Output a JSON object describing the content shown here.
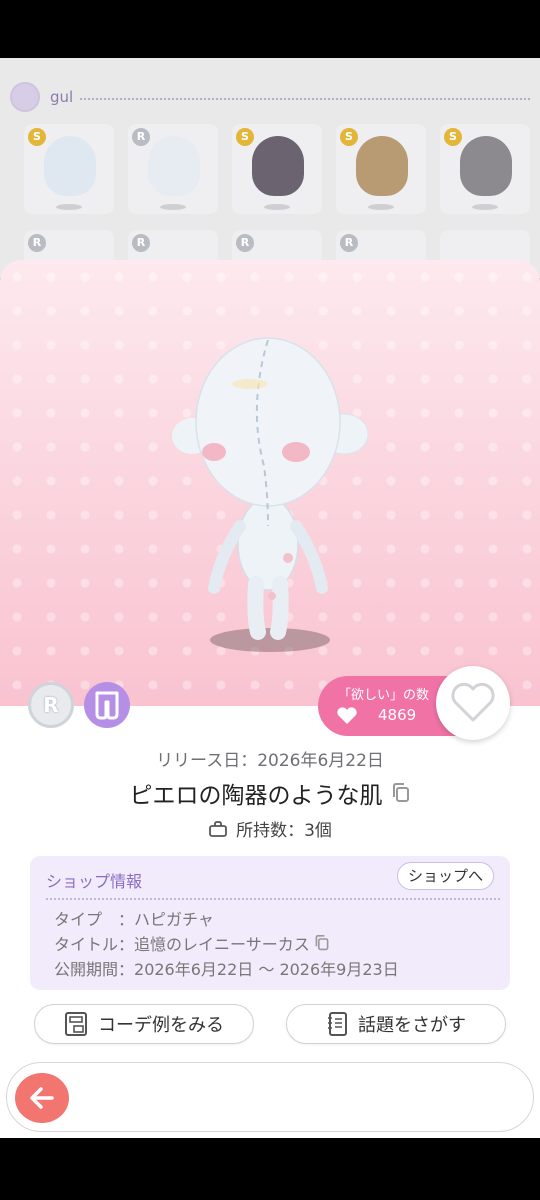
{
  "background": {
    "username": "gul",
    "grid_rarities": [
      "S",
      "R",
      "S",
      "S",
      "S",
      "R",
      "R",
      "R",
      "R",
      ""
    ]
  },
  "item": {
    "rarity": "R",
    "want_label": "「欲しい」の数",
    "want_count": "4869",
    "release_date": "リリース日：2026年6月22日",
    "name": "ピエロの陶器のような肌",
    "owned": "所持数：3個"
  },
  "shop": {
    "header": "ショップ情報",
    "goto_label": "ショップへ",
    "rows": [
      {
        "key": "タイプ　：",
        "value": "ハピガチャ"
      },
      {
        "key": "タイトル：",
        "value": "追憶のレイニーサーカス"
      },
      {
        "key": "公開期間：",
        "value": "2026年6月22日 ～ 2026年9月23日"
      }
    ]
  },
  "actions": {
    "coordinate_label": "コーデ例をみる",
    "topic_label": "話題をさがす"
  },
  "colors": {
    "accent_pink": "#f173a6",
    "accent_purple": "#b58fe6",
    "back_button": "#f2756f"
  }
}
